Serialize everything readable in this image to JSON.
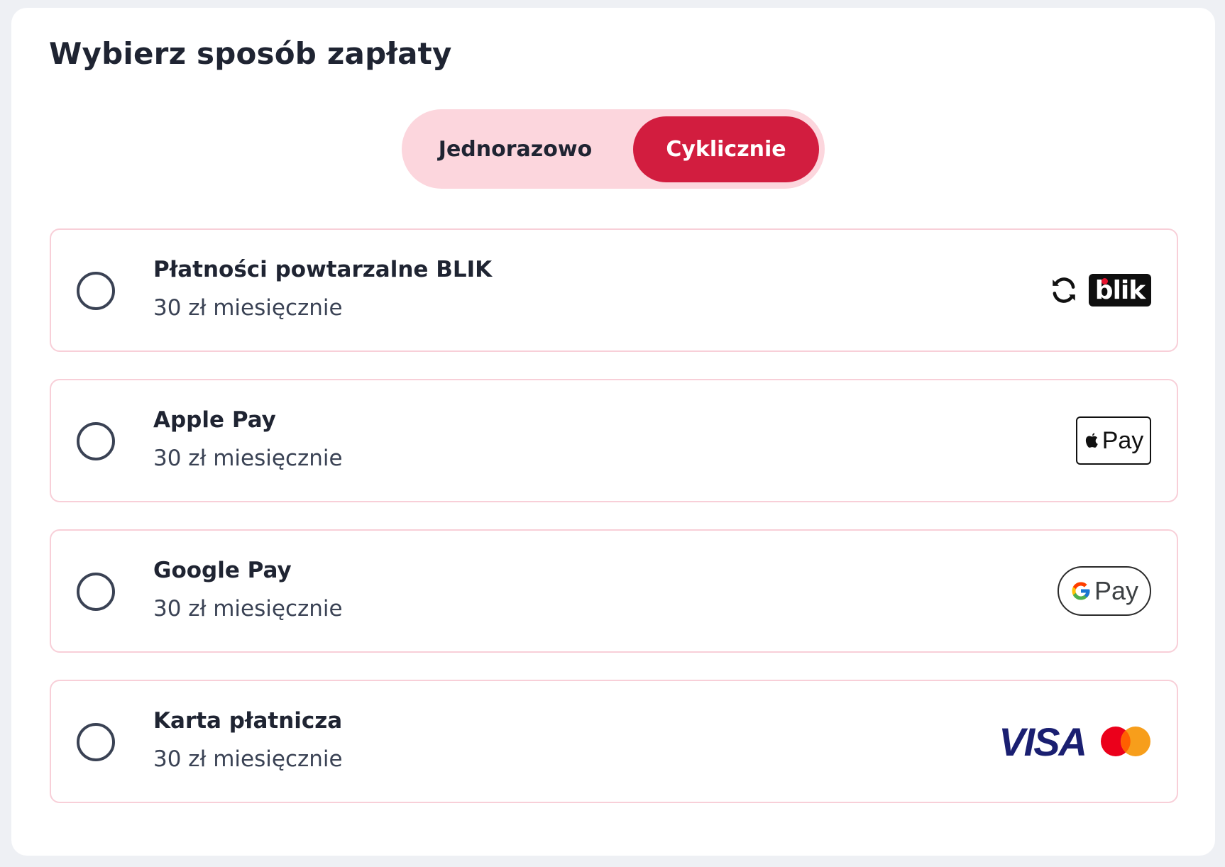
{
  "title": "Wybierz sposób zapłaty",
  "toggle": {
    "options": [
      "Jednorazowo",
      "Cyklicznie"
    ],
    "selected": "Cyklicznie"
  },
  "colors": {
    "accent": "#d21d3f",
    "toggle_bg": "#fcd6dd",
    "card_border": "#f8cfd8"
  },
  "payment_methods": [
    {
      "title": "Płatności powtarzalne BLIK",
      "price": "30 zł miesięcznie",
      "logo_text": "blik",
      "icons": [
        "sync-icon",
        "blik-logo"
      ]
    },
    {
      "title": "Apple Pay",
      "price": "30 zł miesięcznie",
      "logo_text": "Pay",
      "icons": [
        "apple-pay-logo"
      ]
    },
    {
      "title": "Google Pay",
      "price": "30 zł miesięcznie",
      "logo_text": "Pay",
      "icons": [
        "google-pay-logo"
      ]
    },
    {
      "title": "Karta płatnicza",
      "price": "30 zł miesięcznie",
      "logo_text": "VISA",
      "icons": [
        "visa-logo",
        "mastercard-logo"
      ]
    }
  ]
}
